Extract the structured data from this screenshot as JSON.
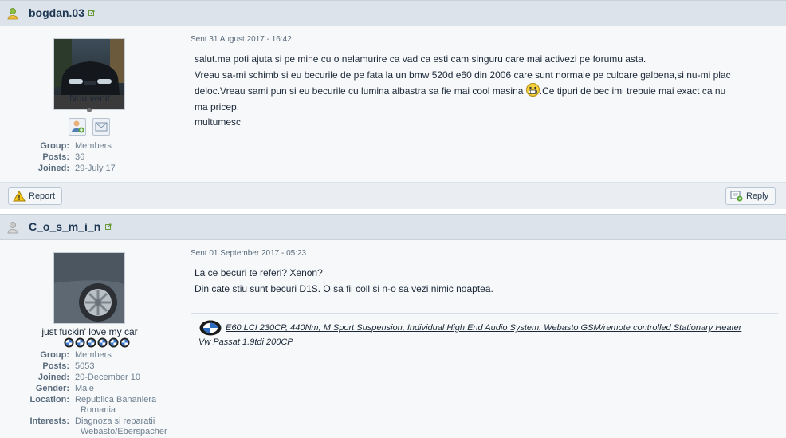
{
  "post1": {
    "author": "bogdan.03",
    "rank": "Nou venit",
    "date": "Sent 31 August 2017 - 16:42",
    "info": [
      {
        "k": "Group:",
        "v": "Members"
      },
      {
        "k": "Posts:",
        "v": "36"
      },
      {
        "k": "Joined:",
        "v": "29-July 17"
      }
    ],
    "message": {
      "l1": "salut.ma poti ajuta si pe mine cu o nelamurire ca vad ca esti cam singuru care mai activezi pe forumu asta.",
      "l2": "Vreau sa-mi schimb si eu becurile de pe fata la un bmw 520d e60 din 2006 care sunt normale pe culoare galbena,si nu-mi plac",
      "l3a": "deloc.Vreau sami pun si eu becurile cu lumina albastra sa fie mai cool masina ",
      "l3b": ".Ce tipuri de bec imi trebuie mai exact ca nu",
      "l4": "ma pricep.",
      "l5": "multumesc"
    },
    "report_label": "Report",
    "reply_label": "Reply"
  },
  "post2": {
    "author": "C_o_s_m_i_n",
    "rank": "just fuckin' love my car",
    "date": "Sent 01 September 2017 - 05:23",
    "info": [
      {
        "k": "Group:",
        "v": "Members"
      },
      {
        "k": "Posts:",
        "v": "5053"
      },
      {
        "k": "Joined:",
        "v": "20-December 10"
      },
      {
        "k": "Gender:",
        "v": "Male"
      },
      {
        "k": "Location:",
        "v": "Republica Bananiera"
      },
      {
        "k": "",
        "v": "Romania"
      },
      {
        "k": "Interests:",
        "v": "Diagnoza si reparatii"
      },
      {
        "k": "",
        "v": "Webasto/Eberspacher"
      }
    ],
    "message": {
      "l1": "La ce becuri te referi? Xenon?",
      "l2": "Din cate stiu sunt becuri D1S. O sa fii coll si n-o sa vezi nimic noaptea."
    },
    "signature": {
      "line1": "E60 LCI 230CP, 440Nm, M Sport Suspension, Individual High End Audio System, Webasto GSM/remote controlled Stationary Heater",
      "line2": "Vw Passat 1.9tdi 200CP"
    }
  },
  "colors": {
    "header_bg": "#dce3ea",
    "author": "#1d3652",
    "body_bg": "#f6f8fa"
  },
  "icons": [
    "user-online-icon",
    "user-offline-icon",
    "external-link-icon",
    "add-friend-icon",
    "send-pm-icon",
    "warning-icon",
    "reply-icon",
    "grin-emoticon-icon",
    "bmw-logo-icon",
    "star-pip-icon"
  ]
}
